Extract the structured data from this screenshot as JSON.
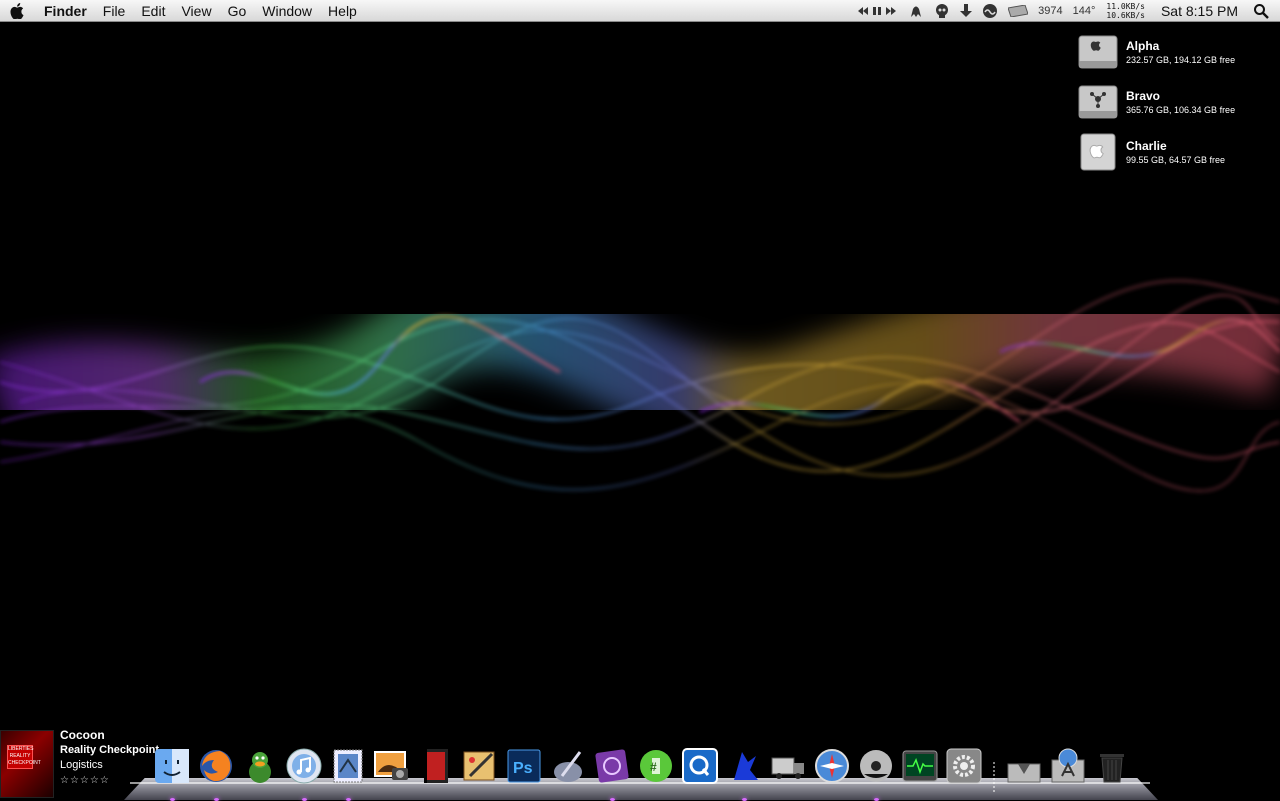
{
  "menubar": {
    "apple_icon": "apple-logo",
    "app_name": "Finder",
    "menus": [
      "File",
      "Edit",
      "View",
      "Go",
      "Window",
      "Help"
    ],
    "status": {
      "cpu_count": "3974",
      "temperature": "144°",
      "net_up": "11.0KB/s",
      "net_down": "10.6KB/s",
      "clock": "Sat 8:15 PM"
    }
  },
  "drives": [
    {
      "name": "Alpha",
      "info": "232.57 GB, 194.12 GB free",
      "icon": "apple-hard-drive-icon"
    },
    {
      "name": "Bravo",
      "info": "365.76 GB, 106.34 GB free",
      "icon": "firewire-drive-icon"
    },
    {
      "name": "Charlie",
      "info": "99.55 GB, 64.57 GB free",
      "icon": "apple-drive-icon"
    }
  ],
  "now_playing": {
    "album": "Cocoon",
    "track": "Reality Checkpoint",
    "artist": "Logistics",
    "rating": "☆☆☆☆☆",
    "art_text": "LIBERTIES REALITY CHECKPOINT"
  },
  "dock": {
    "apps": [
      "finder",
      "firefox",
      "adium",
      "itunes",
      "mail",
      "iphoto",
      "imovie",
      "pixelmator",
      "photoshop",
      "script-editor",
      "ical-pro",
      "messages",
      "quicksilver",
      "wireshark",
      "transmit",
      "safari",
      "dvd-player",
      "activity-monitor",
      "system-preferences"
    ],
    "stacks": [
      "downloads",
      "applications",
      "trash"
    ],
    "colors": {
      "accent": "#d86bff"
    }
  }
}
